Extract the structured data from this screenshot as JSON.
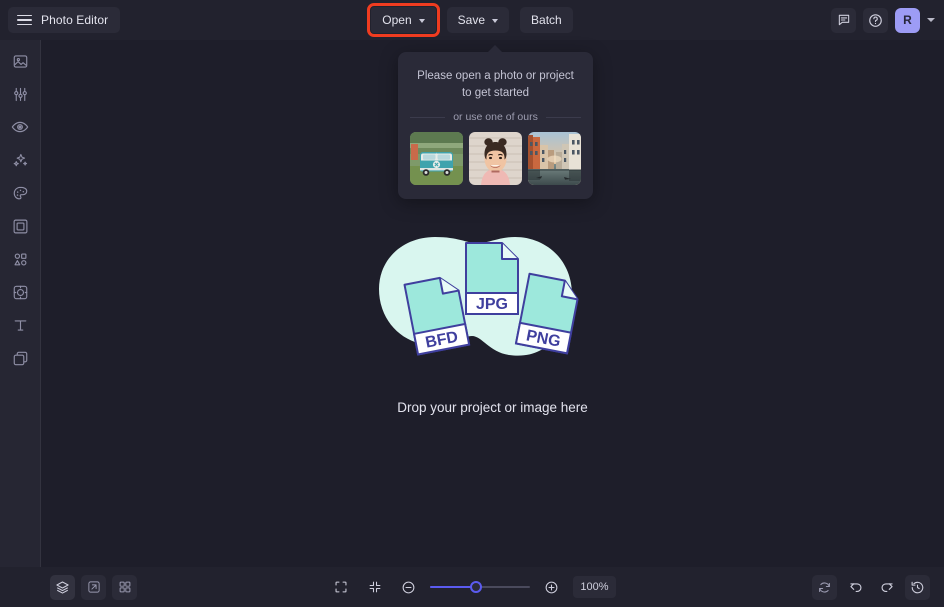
{
  "app": {
    "title": "Photo Editor",
    "menu_icon": "hamburger-icon"
  },
  "header": {
    "buttons": [
      {
        "label": "Open",
        "icon": "chevron-down-icon",
        "highlighted": true
      },
      {
        "label": "Save",
        "icon": "chevron-down-icon",
        "highlighted": false
      },
      {
        "label": "Batch",
        "icon": "",
        "highlighted": false
      }
    ],
    "right_icons": [
      {
        "name": "feedback-icon"
      },
      {
        "name": "help-icon"
      }
    ],
    "avatar": {
      "initial": "R",
      "color": "#9d9cf5"
    },
    "highlight_color": "#f03c20"
  },
  "sidebar": {
    "items": [
      {
        "name": "image-icon",
        "label": "Image"
      },
      {
        "name": "adjust-icon",
        "label": "Adjust"
      },
      {
        "name": "eye-icon",
        "label": "Retouch"
      },
      {
        "name": "sparkles-icon",
        "label": "Effects"
      },
      {
        "name": "palette-icon",
        "label": "Color"
      },
      {
        "name": "frame-icon",
        "label": "Frames"
      },
      {
        "name": "shapes-icon",
        "label": "Elements"
      },
      {
        "name": "stickers-icon",
        "label": "Stickers"
      },
      {
        "name": "text-icon",
        "label": "Text"
      },
      {
        "name": "layers-overlay-icon",
        "label": "Overlays"
      }
    ]
  },
  "popup": {
    "title": "Please open a photo or project to get started",
    "divider_text": "or use one of ours",
    "thumbnails": [
      {
        "name": "thumbnail-vw-bus",
        "alt": "Teal VW bus on grass"
      },
      {
        "name": "thumbnail-portrait",
        "alt": "Portrait of smiling woman"
      },
      {
        "name": "thumbnail-canal",
        "alt": "City canal at sunset"
      }
    ]
  },
  "dropzone": {
    "text": "Drop your project or image here",
    "files": [
      "BFD",
      "JPG",
      "PNG"
    ],
    "blob_color": "#d9f6ef",
    "file_fill": "#9de8dc",
    "file_stroke": "#3f3f9e"
  },
  "footer": {
    "left_icons": [
      {
        "name": "layers-icon",
        "active": true
      },
      {
        "name": "compare-icon",
        "active": false
      },
      {
        "name": "grid-icon",
        "active": false
      }
    ],
    "center_icons": [
      {
        "name": "fit-screen-icon"
      },
      {
        "name": "fit-content-icon"
      }
    ],
    "zoom_out_icon": "minus-circle-icon",
    "zoom_in_icon": "plus-circle-icon",
    "zoom_level": "100%",
    "slider_value": 46,
    "slider_color": "#5b5bf0",
    "right_icons": [
      {
        "name": "reset-icon"
      },
      {
        "name": "undo-icon"
      },
      {
        "name": "redo-icon"
      },
      {
        "name": "history-icon"
      }
    ]
  }
}
